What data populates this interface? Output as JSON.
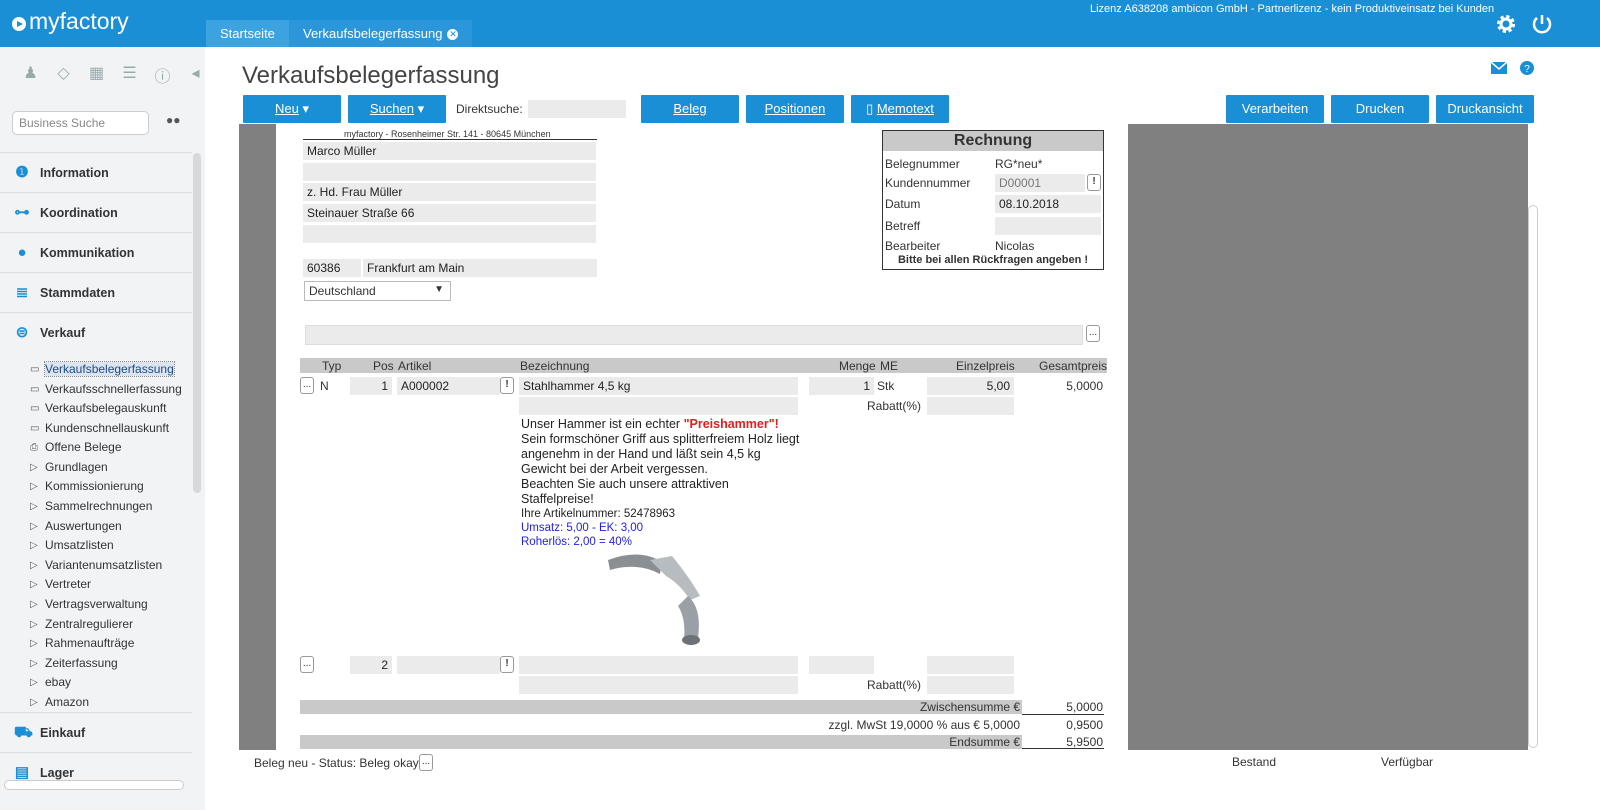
{
  "app": {
    "logo": "myfactory",
    "license": "Lizenz A638208 ambicon GmbH - Partnerlizenz - kein Produktiveinsatz bei Kunden"
  },
  "tabs": [
    {
      "label": "Startseite"
    },
    {
      "label": "Verkaufsbelegerfassung"
    }
  ],
  "sidebar": {
    "search_placeholder": "Business Suche",
    "sections": [
      {
        "label": "Information",
        "icon": "info-icon"
      },
      {
        "label": "Koordination",
        "icon": "network-icon"
      },
      {
        "label": "Kommunikation",
        "icon": "chat-icon"
      },
      {
        "label": "Stammdaten",
        "icon": "database-icon"
      },
      {
        "label": "Verkauf",
        "icon": "coins-icon"
      },
      {
        "label": "Einkauf",
        "icon": "cart-icon"
      },
      {
        "label": "Lager",
        "icon": "warehouse-icon"
      }
    ],
    "items": [
      "Verkaufsbelegerfassung",
      "Verkaufsschnellerfassung",
      "Verkaufsbelegauskunft",
      "Kundenschnellauskunft",
      "Offene Belege",
      "Grundlagen",
      "Kommissionierung",
      "Sammelrechnungen",
      "Auswertungen",
      "Umsatzlisten",
      "Variantenumsatzlisten",
      "Vertreter",
      "Vertragsverwaltung",
      "Zentralregulierer",
      "Rahmenaufträge",
      "Zeiterfassung",
      "ebay",
      "Amazon"
    ]
  },
  "page": {
    "title": "Verkaufsbelegerfassung",
    "direktsuche_label": "Direktsuche:",
    "buttons": {
      "neu": "Neu",
      "suchen": "Suchen",
      "beleg": "Beleg",
      "positionen": "Positionen",
      "memotext": "Memotext",
      "verarbeiten": "Verarbeiten",
      "drucken": "Drucken",
      "druckansicht": "Druckansicht"
    }
  },
  "address": {
    "sender": "myfactory - Rosenheimer Str. 141 - 80645 München",
    "name": "Marco Müller",
    "line2": "",
    "attn": "z. Hd. Frau Müller",
    "street": "Steinauer Straße 66",
    "line5": "",
    "zip": "60386",
    "city": "Frankfurt am Main",
    "country": "Deutschland"
  },
  "invoice": {
    "title": "Rechnung",
    "belegnummer_label": "Belegnummer",
    "belegnummer": "RG*neu*",
    "kundennummer_label": "Kundennummer",
    "kundennummer": "D00001",
    "datum_label": "Datum",
    "datum": "08.10.2018",
    "betreff_label": "Betreff",
    "betreff": "",
    "bearbeiter_label": "Bearbeiter",
    "bearbeiter": "Nicolas",
    "note": "Bitte bei allen Rückfragen angeben !"
  },
  "table": {
    "headers": {
      "typ": "Typ",
      "pos": "Pos",
      "artikel": "Artikel",
      "bezeichnung": "Bezeichnung",
      "menge": "Menge",
      "me": "ME",
      "einzelpreis": "Einzelpreis",
      "gesamtpreis": "Gesamtpreis"
    },
    "rows": [
      {
        "typ": "N",
        "pos": "1",
        "artikel": "A000002",
        "bezeichnung": "Stahlhammer 4,5 kg",
        "menge": "1",
        "me": "Stk",
        "einzelpreis": "5,00",
        "gesamtpreis": "5,0000",
        "rabatt_label": "Rabatt(%)"
      },
      {
        "typ": "",
        "pos": "2",
        "artikel": "",
        "bezeichnung": "",
        "menge": "",
        "me": "",
        "einzelpreis": "",
        "gesamtpreis": "",
        "rabatt_label": "Rabatt(%)"
      }
    ],
    "description": {
      "line1a": "Unser Hammer ist ein echter ",
      "line1b": "\"Preishammer\"!",
      "body": "Sein formschöner Griff aus splitterfreiem Holz liegt angenehm in der Hand und läßt sein 4,5 kg Gewicht bei der Arbeit vergessen.",
      "body2": "Beachten Sie auch unsere attraktiven Staffelpreise!",
      "artnr": "Ihre Artikelnummer: 52478963",
      "umsatz": "Umsatz: 5,00 - EK: 3,00",
      "roherloes": "Roherlös: 2,00 = 40%"
    }
  },
  "totals": {
    "zwischensumme_label": "Zwischensumme €",
    "zwischensumme": "5,0000",
    "mwst_label": "zzgl. MwSt 19,0000 % aus € 5,0000",
    "mwst": "0,9500",
    "endsumme_label": "Endsumme €",
    "endsumme": "5,9500"
  },
  "status": {
    "text": "Beleg neu - Status: Beleg okay",
    "bestand": "Bestand",
    "verfuegbar": "Verfügbar"
  },
  "ellipsis": "...",
  "excl": "!"
}
